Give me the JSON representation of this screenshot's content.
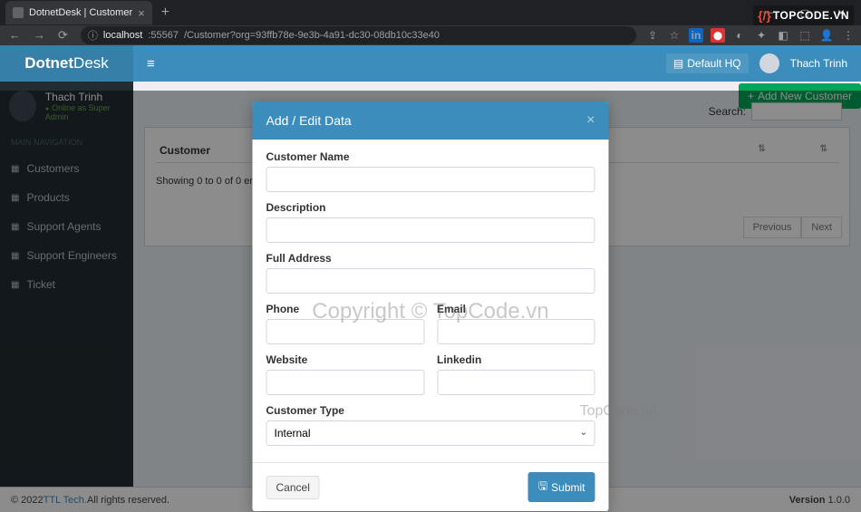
{
  "browser": {
    "tab_title": "DotnetDesk | Customer",
    "url_host": "localhost",
    "url_port": ":55567",
    "url_path": "/Customer?org=93ffb78e-9e3b-4a91-dc30-08db10c33e40"
  },
  "brand": {
    "bold": "Dotnet",
    "light": "Desk"
  },
  "header": {
    "hq_label": "Default HQ",
    "username": "Thach Trinh"
  },
  "sidebar": {
    "user_name": "Thach Trinh",
    "user_status": "Online as Super Admin",
    "section": "MAIN NAVIGATION",
    "items": [
      "Customers",
      "Products",
      "Support Agents",
      "Support Engineers",
      "Ticket"
    ]
  },
  "page": {
    "add_button": "Add New Customer",
    "search_label": "Search:",
    "column_customer": "Customer",
    "entries_info": "Showing 0 to 0 of 0 entries",
    "prev": "Previous",
    "next": "Next"
  },
  "modal": {
    "title": "Add / Edit Data",
    "fields": {
      "customer_name": "Customer Name",
      "description": "Description",
      "full_address": "Full Address",
      "phone": "Phone",
      "email": "Email",
      "website": "Website",
      "linkedin": "Linkedin",
      "customer_type": "Customer Type"
    },
    "customer_type_value": "Internal",
    "cancel": "Cancel",
    "submit": "Submit"
  },
  "footer": {
    "copyright_prefix": "© 2022 ",
    "company": "TTL Tech.",
    "rights": " All rights reserved.",
    "version_label": "Version ",
    "version": "1.0.0"
  },
  "watermark": {
    "center": "Copyright © TopCode.vn",
    "side": "TopCode.vn",
    "logo": "TOPCODE.VN"
  }
}
